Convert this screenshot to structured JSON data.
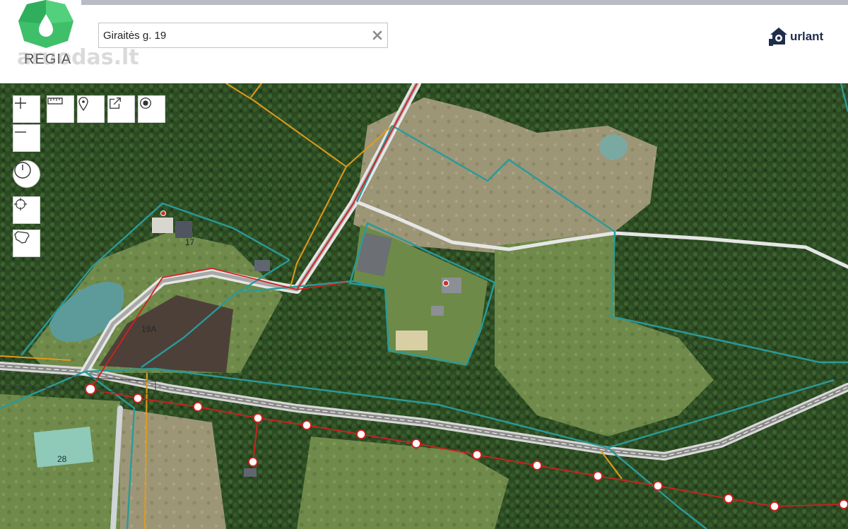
{
  "header": {
    "brand_left": "REGIA",
    "watermark": "aruodas.lt",
    "brand_right": "urlant"
  },
  "search": {
    "value": "Giraitės g. 19"
  },
  "map": {
    "parcel_labels": [
      "17",
      "19A",
      "28"
    ]
  },
  "toolbar": {
    "icons": [
      "zoom-in-icon",
      "zoom-out-icon",
      "measure-icon",
      "marker-icon",
      "share-icon",
      "record-icon",
      "clock-icon",
      "locate-icon",
      "lithuania-icon"
    ]
  },
  "colors": {
    "parcel_boundary": "#2a9a9a",
    "road_outline": "#d9d9d9",
    "power_line": "#d41f1f",
    "utility_line": "#e29a1a",
    "header_bg": "#ffffff",
    "brand_green": "#3fbf6a",
    "brand_navy": "#1f2d4d"
  }
}
